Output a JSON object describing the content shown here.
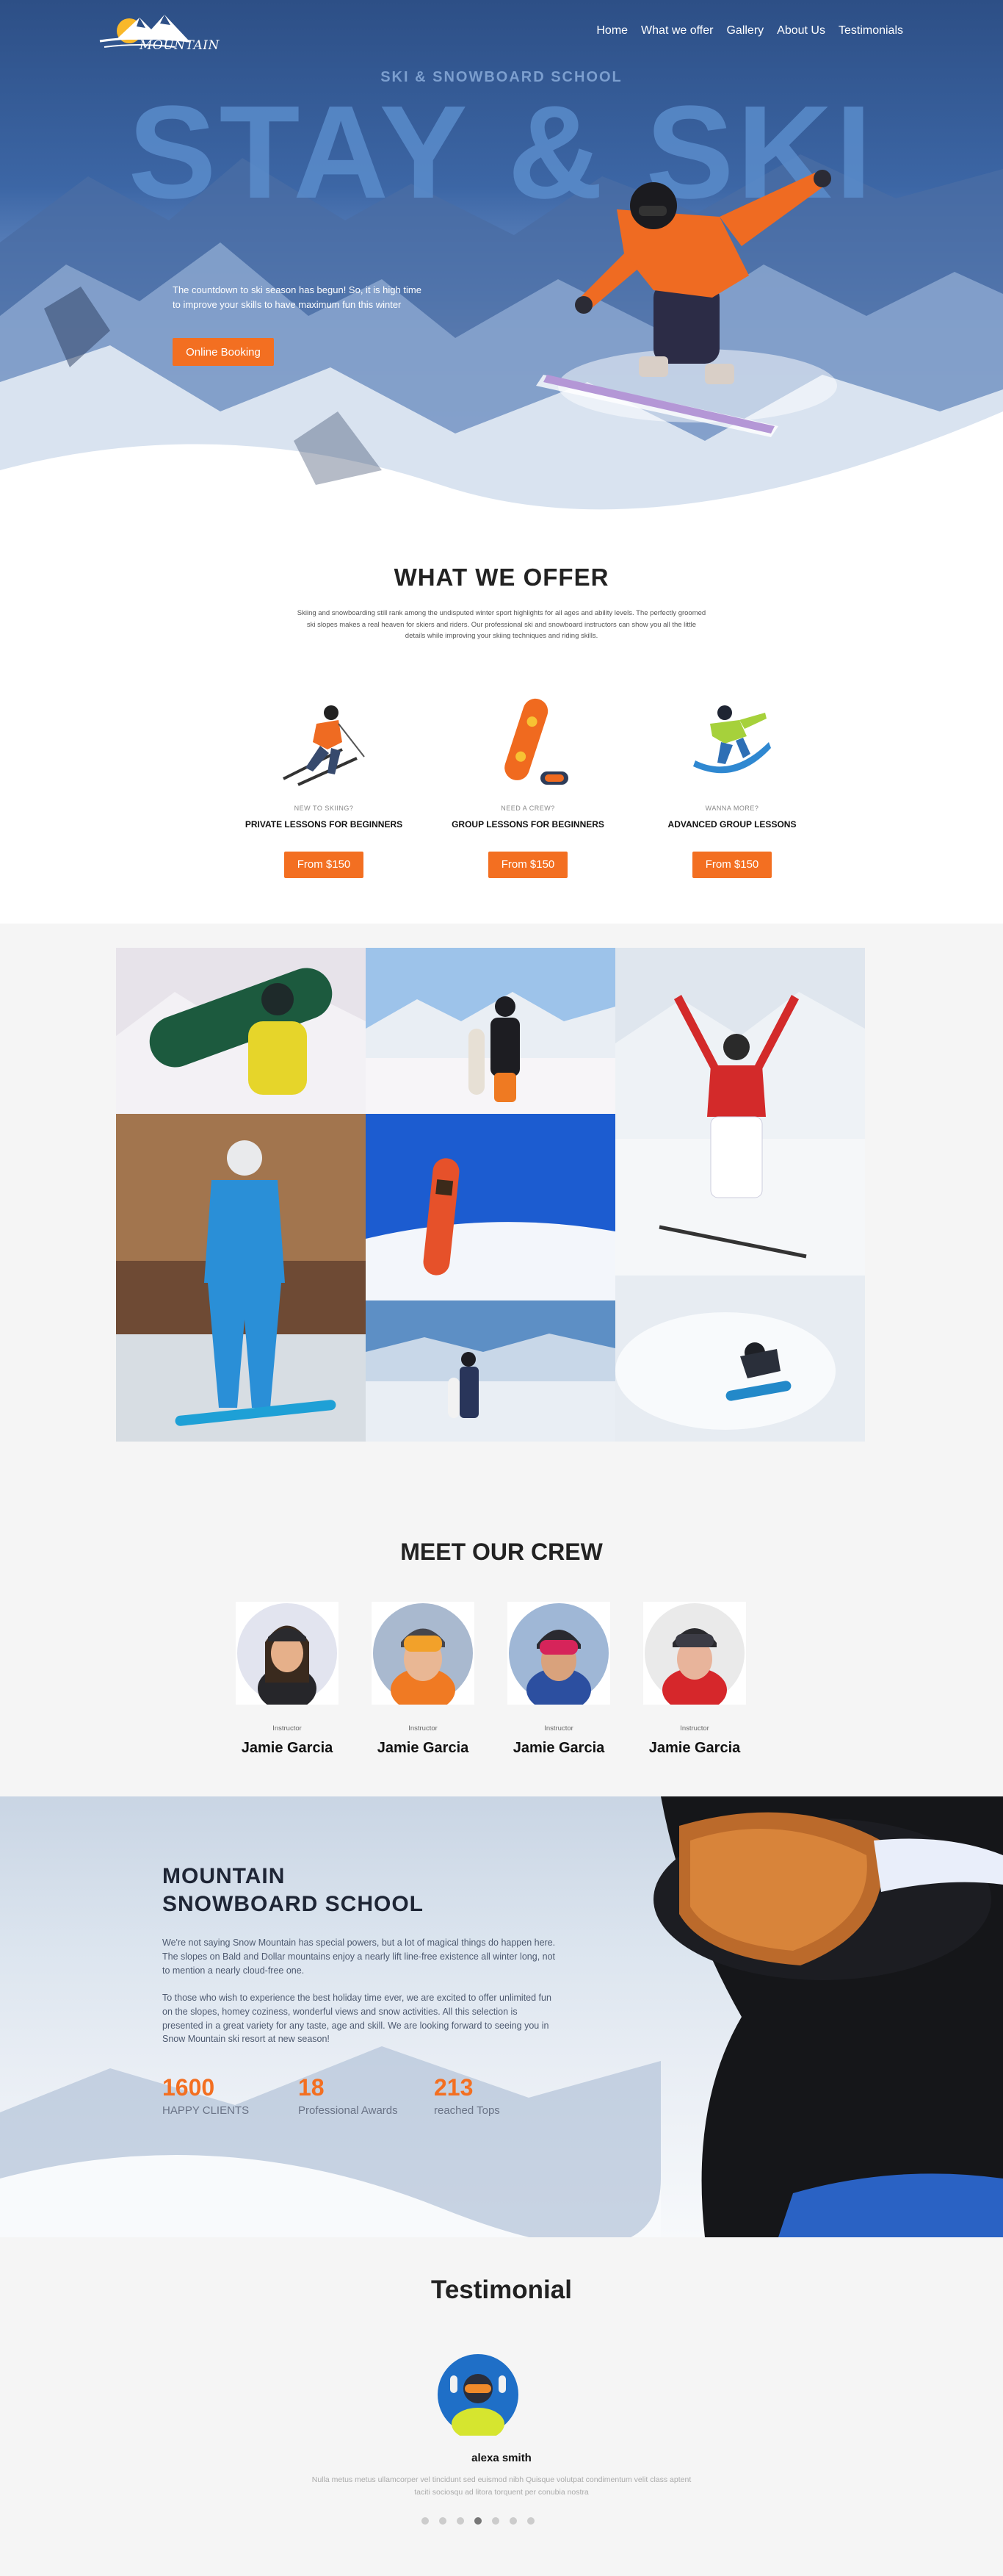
{
  "nav": {
    "logo_text": "MOUNTAIN",
    "items": [
      "Home",
      "What we offer",
      "Gallery",
      "About Us",
      "Testimonials"
    ]
  },
  "hero": {
    "subtitle": "SKI & SNOWBOARD SCHOOL",
    "title": "STAY & SKI",
    "text": "The countdown to ski season has begun! So, it is high time to improve your skills to have maximum fun this winter",
    "button": "Online Booking"
  },
  "offer": {
    "title": "WHAT WE OFFER",
    "description": "Skiing and snowboarding still rank among the undisputed winter sport highlights for all ages and ability levels. The perfectly groomed ski slopes makes a real heaven for skiers and riders. Our professional ski and snowboard instructors can show you all the little details while improving your skiing techniques and riding skills.",
    "cards": [
      {
        "tag": "NEW TO SKIING?",
        "name": "PRIVATE LESSONS FOR BEGINNERS",
        "price": "From $150",
        "icon": "skier-icon"
      },
      {
        "tag": "NEED A CREW?",
        "name": "GROUP LESSONS FOR BEGINNERS",
        "price": "From $150",
        "icon": "snowboard-icon"
      },
      {
        "tag": "WANNA MORE?",
        "name": "ADVANCED GROUP LESSONS",
        "price": "From $150",
        "icon": "snowboarder-icon"
      }
    ]
  },
  "crew": {
    "title": "MEET OUR CREW",
    "members": [
      {
        "role": "Instructor",
        "name": "Jamie Garcia"
      },
      {
        "role": "Instructor",
        "name": "Jamie Garcia"
      },
      {
        "role": "Instructor",
        "name": "Jamie Garcia"
      },
      {
        "role": "Instructor",
        "name": "Jamie Garcia"
      }
    ]
  },
  "about": {
    "title_line1": "MOUNTAIN",
    "title_line2": "SNOWBOARD SCHOOL",
    "p1": "We're not saying Snow Mountain has special powers, but a lot of magical things do happen here. The slopes on Bald and Dollar mountains enjoy a nearly lift line-free existence all winter long, not to mention a nearly cloud-free one.",
    "p2": "To those who wish to experience the best holiday time ever, we are excited to offer unlimited fun on the slopes, homey coziness, wonderful views and snow activities. All this selection is presented in a great variety for any taste, age and skill. We are looking forward to seeing you in Snow Mountain ski resort at new season!",
    "stats": [
      {
        "num": "1600",
        "label": "HAPPY CLIENTS"
      },
      {
        "num": "18",
        "label": "Professional Awards"
      },
      {
        "num": "213",
        "label": "reached Tops"
      }
    ]
  },
  "testimonial": {
    "title": "Testimonial",
    "name": "alexa smith",
    "text": "Nulla metus metus ullamcorper vel tincidunt sed euismod nibh Quisque volutpat condimentum velit class aptent taciti sociosqu ad litora torquent per conubia nostra",
    "dots": 7,
    "active_dot": 3
  },
  "colors": {
    "accent": "#f36f21",
    "hero_blue": "#2d4f86",
    "title_blue": "#5a8ccb"
  }
}
